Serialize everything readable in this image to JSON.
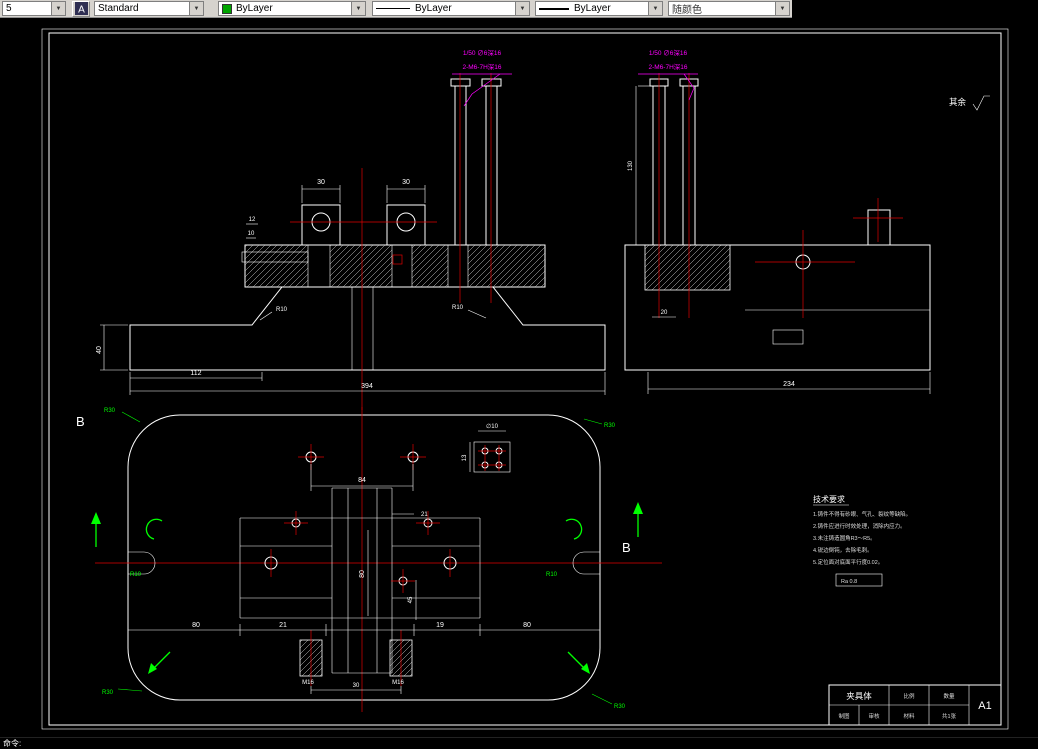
{
  "toolbar": {
    "dimstyle_value": "5",
    "textstyle_value": "Standard",
    "color_value": "ByLayer",
    "linetype_value": "ByLayer",
    "lineweight_value": "ByLayer",
    "plotstyle_value": "随颜色"
  },
  "drawing": {
    "surface_note": "其余",
    "callouts": {
      "line1": "1/50 ∅6深16",
      "line2": "2-M6-7H深16"
    },
    "front_view": {
      "dim_boss_left": "30",
      "dim_boss_right": "30",
      "dim_small_a": "12",
      "dim_small_b": "10",
      "dim_left_height": "40",
      "r_label_left": "R10",
      "r_label_right": "R10",
      "dim_seg": "112",
      "dim_total": "394"
    },
    "side_view": {
      "dim_total": "234",
      "dim_small": "20",
      "dim_height": "130"
    },
    "plan_view": {
      "section_label_left": "B",
      "section_label_right": "B",
      "dim_hole_spacing": "84",
      "dim_slot_top": "21",
      "dim_slot_vert": "80",
      "dim_45": "45",
      "dim_bottom_1": "80",
      "dim_bottom_2": "21",
      "dim_bottom_3": "19",
      "dim_bottom_4": "80",
      "dim_30": "30",
      "thread_label_left": "M16",
      "thread_label_right": "M16",
      "corner_radius": "R30",
      "fillet_label": "R10",
      "detail_dim_a": "∅10",
      "detail_dim_b": "13"
    },
    "tech_requirements": {
      "title": "技术要求",
      "lines": [
        "1.铸件不得有砂眼、气孔、裂纹等缺陷。",
        "2.铸件应进行时效处理，消除内应力。",
        "3.未注铸造圆角R3～R5。",
        "4.锐边倒钝，去除毛刺。",
        "5.定位面对底面平行度0.02。",
        "Ra 0.8"
      ]
    }
  },
  "title_block": {
    "part_name": "夹具体",
    "scale_label": "比例",
    "qty_label": "数量",
    "material_label": "材料",
    "sheet_label": "共1张",
    "drawing_no": "A1",
    "drafter_label": "制图",
    "checker_label": "审核"
  },
  "command_line": {
    "prompt": "命令:"
  }
}
